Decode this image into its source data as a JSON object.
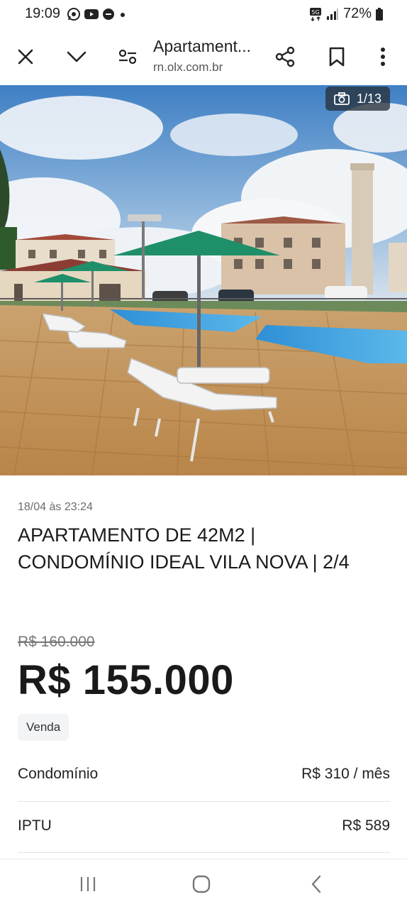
{
  "status_bar": {
    "time": "19:09",
    "network": "5G",
    "battery": "72%",
    "icons": [
      "whatsapp-icon",
      "youtube-icon",
      "notification-icon",
      "dot-icon",
      "signal-icon",
      "battery-icon"
    ]
  },
  "toolbar": {
    "title": "Apartament...",
    "url": "rn.olx.com.br",
    "icons": [
      "close-icon",
      "chevron-down-icon",
      "tune-icon",
      "share-icon",
      "bookmark-icon",
      "more-vertical-icon"
    ]
  },
  "gallery": {
    "counter": "1/13",
    "icon": "camera-icon"
  },
  "listing": {
    "date": "18/04 às 23:24",
    "title": "APARTAMENTO DE 42M2 | CONDOMÍNIO IDEAL VILA NOVA | 2/4",
    "old_price": "R$ 160.000",
    "price": "R$ 155.000",
    "badge": "Venda"
  },
  "details": [
    {
      "label": "Condomínio",
      "value": "R$ 310 / mês"
    },
    {
      "label": "IPTU",
      "value": "R$ 589"
    }
  ],
  "nav_bar": {
    "icons": [
      "recents-icon",
      "home-icon",
      "back-icon"
    ]
  },
  "colors": {
    "sky": "#4a86c8",
    "pool": "#3fa7e0",
    "umbrella": "#1f8f6a",
    "deck": "#c99a5b"
  }
}
